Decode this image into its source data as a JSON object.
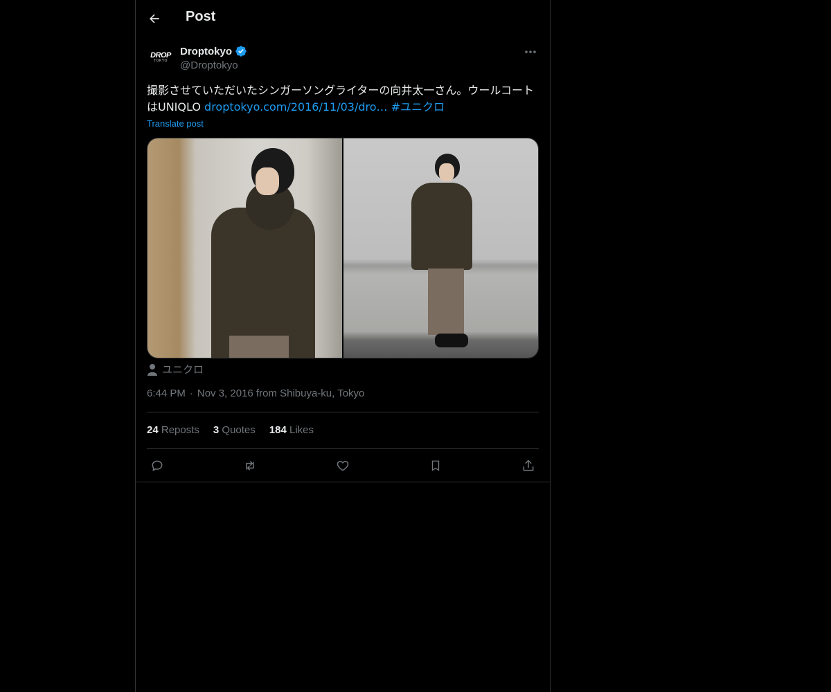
{
  "header": {
    "title": "Post"
  },
  "author": {
    "logo_top": "DROP",
    "logo_bottom": "TOKYO",
    "display_name": "Droptokyo",
    "handle": "@Droptokyo"
  },
  "tweet": {
    "text_prefix": "撮影させていただいたシンガーソングライターの向井太一さん。ウールコートはUNIQLO ",
    "link": "droptokyo.com/2016/11/03/dro…",
    "hashtag": "#ユニクロ",
    "translate_label": "Translate post"
  },
  "tag": {
    "label": "ユニクロ"
  },
  "meta": {
    "time": "6:44 PM",
    "separator": "·",
    "date_location": "Nov 3, 2016 from Shibuya-ku, Tokyo"
  },
  "stats": {
    "reposts_count": "24",
    "reposts_label": "Reposts",
    "quotes_count": "3",
    "quotes_label": "Quotes",
    "likes_count": "184",
    "likes_label": "Likes"
  },
  "colors": {
    "accent": "#1d9bf0",
    "muted_text": "#71767b",
    "border": "#2f3336",
    "background": "#000000"
  },
  "icons": {
    "back": "arrow-left-icon",
    "verified": "verified-badge-icon",
    "more": "more-icon",
    "person": "person-icon",
    "reply": "reply-icon",
    "repost": "repost-icon",
    "like": "heart-icon",
    "bookmark": "bookmark-icon",
    "share": "share-icon"
  }
}
